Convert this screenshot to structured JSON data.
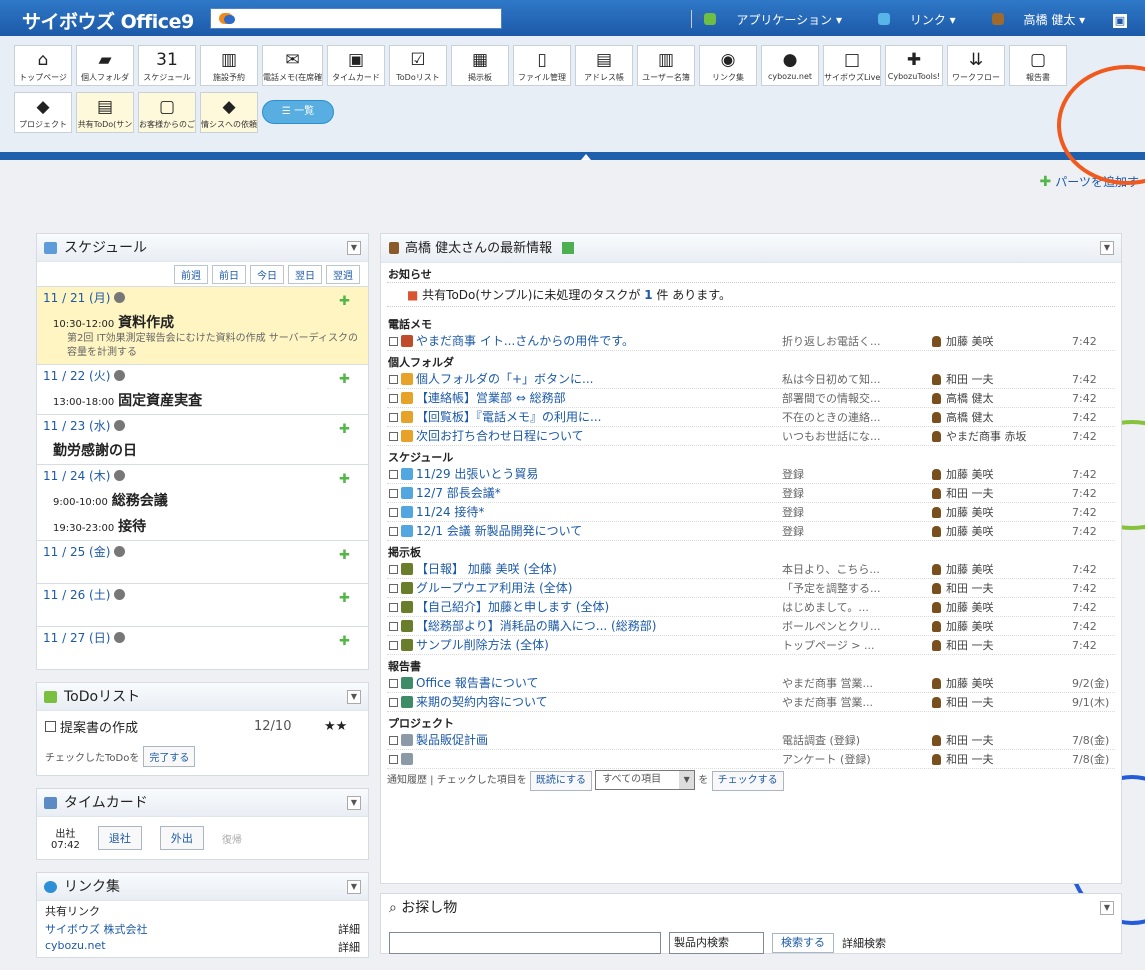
{
  "topbar": {
    "logo": "サイボウズ Office9",
    "app_menu": "アプリケーション",
    "link_menu": "リンク",
    "user": "高橋 健太"
  },
  "apps": [
    {
      "label": "トップページ",
      "icon": "house-icon"
    },
    {
      "label": "個人フォルダ",
      "icon": "folder-icon"
    },
    {
      "label": "スケジュール",
      "icon": "calendar-icon"
    },
    {
      "label": "施設予約",
      "icon": "facility-icon"
    },
    {
      "label": "電話メモ(在席確",
      "icon": "phone-memo-icon"
    },
    {
      "label": "タイムカード",
      "icon": "timecard-icon"
    },
    {
      "label": "ToDoリスト",
      "icon": "todo-icon"
    },
    {
      "label": "掲示板",
      "icon": "bulletin-icon"
    },
    {
      "label": "ファイル管理",
      "icon": "file-icon"
    },
    {
      "label": "アドレス帳",
      "icon": "address-book-icon"
    },
    {
      "label": "ユーザー名簿",
      "icon": "users-icon"
    },
    {
      "label": "リンク集",
      "icon": "globe-icon"
    },
    {
      "label": "cybozu.net",
      "icon": "cloud-icon"
    },
    {
      "label": "サイボウズLive",
      "icon": "live-icon"
    },
    {
      "label": "CybozuTools!",
      "icon": "tools-icon"
    },
    {
      "label": "ワークフロー",
      "icon": "workflow-icon"
    },
    {
      "label": "報告書",
      "icon": "report-icon"
    },
    {
      "label": "プロジェクト",
      "icon": "project-icon"
    },
    {
      "label": "共有ToDo(サン",
      "icon": "shared-todo-icon"
    },
    {
      "label": "お客様からのご",
      "icon": "customer-icon"
    },
    {
      "label": "情シスへの依頼",
      "icon": "request-icon"
    },
    {
      "label": "一覧",
      "icon": "list-icon"
    }
  ],
  "header_right": {
    "add_parts": "パーツを追加す"
  },
  "schedule": {
    "title": "スケジュール",
    "nav": [
      "前週",
      "前日",
      "今日",
      "翌日",
      "翌週"
    ],
    "days": [
      {
        "date": "11 / 21 (月)",
        "events": [
          {
            "time": "10:30-12:00",
            "title": "資料作成",
            "desc": "第2回 IT効果測定報告会にむけた資料の作成 サーバーディスクの容量を計測する"
          }
        ]
      },
      {
        "date": "11 / 22 (火)",
        "events": [
          {
            "time": "13:00-18:00",
            "title": "固定資産実査",
            "desc": ""
          }
        ]
      },
      {
        "date": "11 / 23 (水)",
        "events": [
          {
            "time": "",
            "title": "勤労感謝の日",
            "desc": ""
          }
        ]
      },
      {
        "date": "11 / 24 (木)",
        "events": [
          {
            "time": "9:00-10:00",
            "title": "総務会議",
            "desc": ""
          },
          {
            "time": "19:30-23:00",
            "title": "接待",
            "desc": ""
          }
        ]
      },
      {
        "date": "11 / 25 (金)",
        "events": []
      },
      {
        "date": "11 / 26 (土)",
        "events": []
      },
      {
        "date": "11 / 27 (日)",
        "events": []
      }
    ]
  },
  "todo": {
    "title": "ToDoリスト",
    "item": "提案書の作成",
    "due": "12/10",
    "stars": "★★",
    "footer": "チェックしたToDoを",
    "done_button": "完了する"
  },
  "timecard": {
    "title": "タイムカード",
    "in_label": "出社",
    "in_time": "07:42",
    "leave": "退社",
    "out": "外出",
    "return": "復帰"
  },
  "links": {
    "title": "リンク集",
    "shared": "共有リンク",
    "items": [
      {
        "name": "サイボウズ 株式会社",
        "detail": "詳細"
      },
      {
        "name": "cybozu.net",
        "detail": "詳細"
      }
    ]
  },
  "info": {
    "title": "高橋 健太さんの最新情報",
    "notice_label": "お知らせ",
    "notice_text": "共有ToDo(サンプル)に未処理のタスクが",
    "notice_count": "1",
    "notice_suffix": "件 あります。",
    "sections": [
      {
        "label": "電話メモ",
        "rows": [
          {
            "title": "やまだ商事 イト...さんからの用件です。",
            "preview": "折り返しお電話く...",
            "person": "加藤 美咲",
            "time": "7:42"
          }
        ]
      },
      {
        "label": "個人フォルダ",
        "rows": [
          {
            "title": "個人フォルダの「+」ボタンに...",
            "preview": "私は今日初めて知...",
            "person": "和田 一夫",
            "time": "7:42"
          },
          {
            "title": "【連絡帳】営業部 ⇔ 総務部",
            "preview": "部署間での情報交...",
            "person": "高橋 健太",
            "time": "7:42"
          },
          {
            "title": "【回覧板】『電話メモ』の利用に...",
            "preview": "不在のときの連絡...",
            "person": "高橋 健太",
            "time": "7:42"
          },
          {
            "title": "次回お打ち合わせ日程について",
            "preview": "いつもお世話にな...",
            "person": "やまだ商事 赤坂",
            "time": "7:42"
          }
        ]
      },
      {
        "label": "スケジュール",
        "rows": [
          {
            "title": "11/29 出張いとう貿易",
            "preview": "登録",
            "person": "加藤 美咲",
            "time": "7:42"
          },
          {
            "title": "12/7 部長会議*",
            "preview": "登録",
            "person": "和田 一夫",
            "time": "7:42"
          },
          {
            "title": "11/24 接待*",
            "preview": "登録",
            "person": "加藤 美咲",
            "time": "7:42"
          },
          {
            "title": "12/1 会議 新製品開発について",
            "preview": "登録",
            "person": "加藤 美咲",
            "time": "7:42"
          }
        ]
      },
      {
        "label": "掲示板",
        "rows": [
          {
            "title": "【日報】 加藤 美咲 (全体)",
            "preview": "本日より、こちら...",
            "person": "加藤 美咲",
            "time": "7:42"
          },
          {
            "title": "グループウエア利用法 (全体)",
            "preview": "「予定を調整する...",
            "person": "和田 一夫",
            "time": "7:42"
          },
          {
            "title": "【自己紹介】加藤と申します (全体)",
            "preview": "はじめまして。...",
            "person": "加藤 美咲",
            "time": "7:42"
          },
          {
            "title": "【総務部より】消耗品の購入につ... (総務部)",
            "preview": "ボールペンとクリ...",
            "person": "加藤 美咲",
            "time": "7:42"
          },
          {
            "title": "サンプル削除方法 (全体)",
            "preview": "トップページ > ...",
            "person": "和田 一夫",
            "time": "7:42"
          }
        ]
      },
      {
        "label": "報告書",
        "rows": [
          {
            "title": "Office 報告書について",
            "preview": "やまだ商事 営業...",
            "person": "加藤 美咲",
            "time": "9/2(金)"
          },
          {
            "title": "来期の契約内容について",
            "preview": "やまだ商事 営業...",
            "person": "和田 一夫",
            "time": "9/1(木)"
          }
        ]
      },
      {
        "label": "プロジェクト",
        "rows": [
          {
            "title": "製品販促計画",
            "preview": "電話調査 (登録)",
            "person": "和田 一夫",
            "time": "7/8(金)"
          },
          {
            "title": "",
            "preview": "アンケート (登録)",
            "person": "和田 一夫",
            "time": "7/8(金)"
          }
        ]
      }
    ],
    "footer": {
      "history": "通知履歴",
      "checked": "チェックした項目を",
      "read_button": "既読にする",
      "select": "すべての項目",
      "to": "を",
      "check_button": "チェックする"
    }
  },
  "search": {
    "title": "お探し物",
    "select": "製品内検索",
    "button": "検索する",
    "detail": "詳細検索"
  },
  "colors": {
    "brand_blue": "#1c5aa8",
    "highlight_yellow": "#fff5c2",
    "annotation_orange": "#f05a1e",
    "annotation_green": "#86c23c",
    "annotation_blue": "#245bd8"
  }
}
